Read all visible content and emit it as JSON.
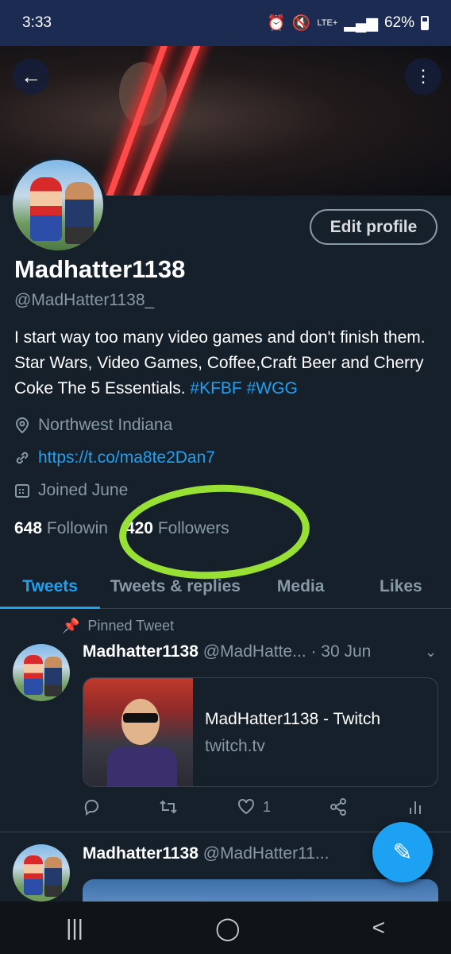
{
  "status_bar": {
    "time": "3:33",
    "network": "LTE+",
    "battery": "62%"
  },
  "header": {
    "back_icon": "arrow-left-icon",
    "more_icon": "more-vertical-icon"
  },
  "profile": {
    "edit_label": "Edit profile",
    "name": "Madhatter1138",
    "handle": "@MadHatter1138_",
    "bio_text": "I start way too many video games and don't finish them. Star Wars, Video Games, Coffee,Craft Beer and Cherry Coke The 5 Essentials.",
    "hashtag1": "#KFBF",
    "hashtag2": "#WGG",
    "location": "Northwest Indiana",
    "url": "https://t.co/ma8te2Dan7",
    "joined": "Joined June",
    "following_count": "648",
    "following_label": "Followin",
    "followers_count": "420",
    "followers_label": "Followers"
  },
  "tabs": [
    "Tweets",
    "Tweets & replies",
    "Media",
    "Likes"
  ],
  "active_tab": "Tweets",
  "tweets": [
    {
      "pinned_label": "Pinned Tweet",
      "name": "Madhatter1138",
      "handle": "@MadHatte...",
      "date": "· 30 Jun",
      "card_title": "MadHatter1138 - Twitch",
      "card_domain": "twitch.tv",
      "likes": "1"
    },
    {
      "name": "Madhatter1138",
      "handle": "@MadHatter11..."
    }
  ],
  "colors": {
    "background": "#15202b",
    "accent": "#1da1f2",
    "highlight": "#98e034"
  }
}
